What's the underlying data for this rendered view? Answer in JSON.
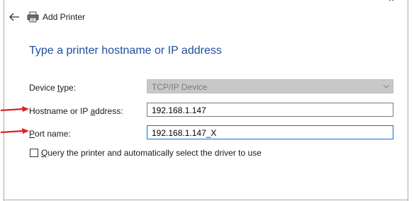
{
  "dialog": {
    "close_glyph": "×",
    "title": "Add Printer",
    "heading": "Type a printer hostname or IP address"
  },
  "fields": {
    "device_type": {
      "label_pre": "Device ",
      "label_accel": "t",
      "label_post": "ype:",
      "value": "TCP/IP Device"
    },
    "hostname": {
      "label_pre": "Hostname or IP ",
      "label_accel": "a",
      "label_post": "ddress:",
      "value": "192.168.1.147"
    },
    "port_name": {
      "label_pre": "",
      "label_accel": "P",
      "label_post": "ort name:",
      "value": "192.168.1.147_X"
    }
  },
  "query_checkbox": {
    "label_accel": "Q",
    "label_post": "uery the printer and automatically select the driver to use",
    "checked": false
  },
  "annotation": {
    "arrow_color": "#e02020"
  }
}
